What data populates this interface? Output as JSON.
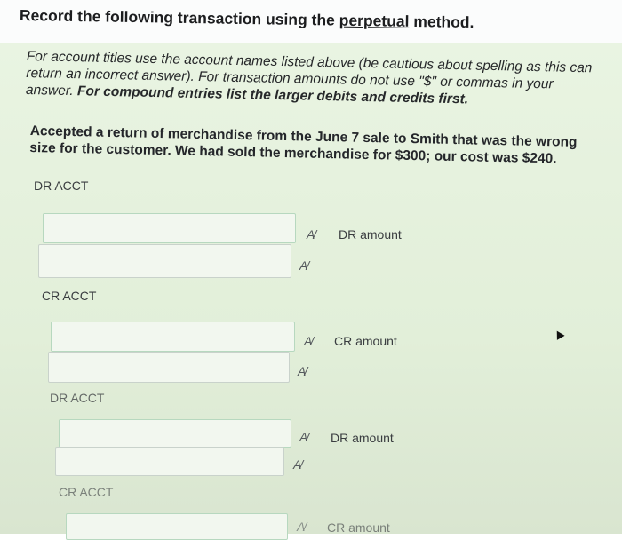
{
  "title": {
    "prefix": "Record the following transaction using the",
    "underlined": "perpetual",
    "suffix": "method."
  },
  "instructions": {
    "part1": "For account titles use the account names listed above (be cautious about spelling as this can return an incorrect answer). For transaction amounts do not use \"$\" or commas in your answer.",
    "bold": "For compound entries list the larger debits and credits first."
  },
  "question": "Accepted a return of merchandise from the June 7 sale to Smith that was the wrong size for the customer. We had sold the merchandise for $300; our cost was $240.",
  "spell_check": "A/",
  "entries": [
    {
      "acct_label": "DR ACCT",
      "amount_label": "DR amount"
    },
    {
      "acct_label": "CR ACCT",
      "amount_label": "CR amount"
    },
    {
      "acct_label": "DR ACCT",
      "amount_label": "DR amount"
    },
    {
      "acct_label": "CR ACCT",
      "amount_label": "CR amount"
    }
  ]
}
